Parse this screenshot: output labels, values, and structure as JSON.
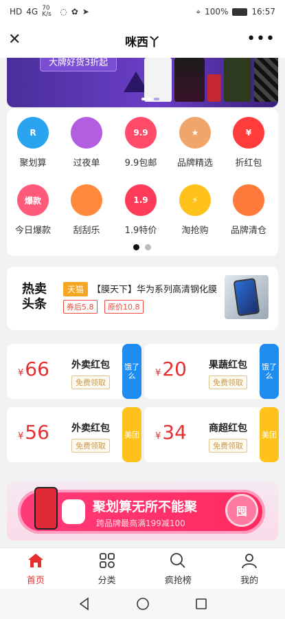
{
  "status": {
    "left_items": [
      "HD",
      "4G",
      "70 K/s"
    ],
    "battery": "100%",
    "time": "16:57"
  },
  "header": {
    "close_glyph": "✕",
    "title": "咪西丫",
    "more_glyph": "•••"
  },
  "banner": {
    "tag": "大牌好货3折起",
    "bg_colors": [
      "#4a2e9a",
      "#6b3fc8"
    ]
  },
  "grid": [
    {
      "label": "聚划算",
      "icon": "juhuasuan-icon",
      "icon_text": "R",
      "color": "#2aa3f0"
    },
    {
      "label": "过夜单",
      "icon": "receipt-icon",
      "icon_text": "",
      "color": "#b35ee0"
    },
    {
      "label": "9.9包邮",
      "icon": "bag-icon",
      "icon_text": "9.9",
      "color": "#ff4a6a"
    },
    {
      "label": "品牌精选",
      "icon": "badge-icon",
      "icon_text": "★",
      "color": "#f0a56a"
    },
    {
      "label": "折红包",
      "icon": "red-envelope-icon",
      "icon_text": "¥",
      "color": "#ff3b3b"
    },
    {
      "label": "今日爆款",
      "icon": "hot-icon",
      "icon_text": "爆款",
      "color": "#ff5a7a"
    },
    {
      "label": "刮刮乐",
      "icon": "scratch-card-icon",
      "icon_text": "",
      "color": "#ff8a3d"
    },
    {
      "label": "1.9特价",
      "icon": "bag-icon",
      "icon_text": "1.9",
      "color": "#ff3b5a"
    },
    {
      "label": "淘抢购",
      "icon": "lightning-clock-icon",
      "icon_text": "⚡",
      "color": "#ffc21a"
    },
    {
      "label": "品牌清仓",
      "icon": "price-tag-icon",
      "icon_text": "",
      "color": "#ff7a3a"
    }
  ],
  "grid_pager": {
    "pages": 2,
    "active": 0
  },
  "news": {
    "logo_line1": "热卖",
    "logo_line2": "头条",
    "shop_tag": "天猫",
    "headline": "【膜天下】华为系列高清钢化膜",
    "coupon_chip": "券后5.8",
    "price_chip": "原价10.8"
  },
  "coupons": [
    {
      "amount": "66",
      "currency": "¥",
      "name": "外卖红包",
      "button": "免费领取",
      "side": "饿了么",
      "side_icon": "eleme-icon",
      "side_color": "#1e8cf0"
    },
    {
      "amount": "20",
      "currency": "¥",
      "name": "果蔬红包",
      "button": "免费领取",
      "side": "饿了么",
      "side_icon": "eleme-icon",
      "side_color": "#1e8cf0"
    },
    {
      "amount": "56",
      "currency": "¥",
      "name": "外卖红包",
      "button": "免费领取",
      "side": "美团",
      "side_icon": "meituan-icon",
      "side_color": "#ffc21a"
    },
    {
      "amount": "34",
      "currency": "¥",
      "name": "商超红包",
      "button": "免费领取",
      "side": "美团",
      "side_icon": "meituan-icon",
      "side_color": "#ffc21a"
    }
  ],
  "promo": {
    "headline": "聚划算无所不能聚",
    "subline": "跨品牌最高满199减100",
    "badge": "囤"
  },
  "tabs": [
    {
      "label": "首页",
      "icon": "home-icon",
      "active": true
    },
    {
      "label": "分类",
      "icon": "category-icon",
      "active": false
    },
    {
      "label": "疯抢榜",
      "icon": "search-icon",
      "active": false
    },
    {
      "label": "我的",
      "icon": "user-icon",
      "active": false
    }
  ]
}
